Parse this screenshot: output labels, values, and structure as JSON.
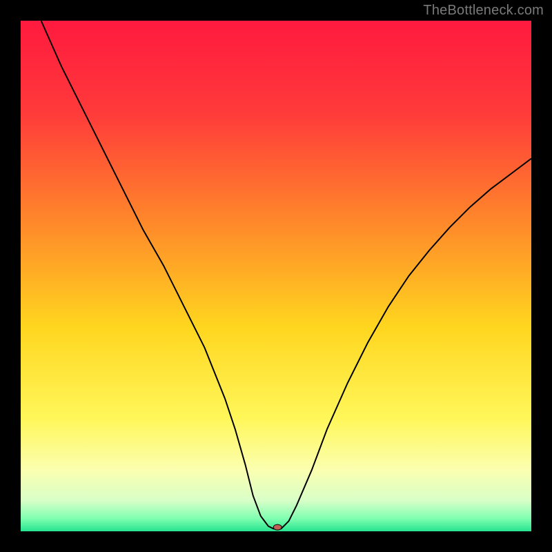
{
  "watermark": "TheBottleneck.com",
  "chart_data": {
    "type": "line",
    "title": "",
    "xlabel": "",
    "ylabel": "",
    "xlim": [
      0,
      100
    ],
    "ylim": [
      0,
      100
    ],
    "background_gradient": {
      "stops": [
        {
          "offset": 0.0,
          "color": "#ff1a3f"
        },
        {
          "offset": 0.18,
          "color": "#ff3a3a"
        },
        {
          "offset": 0.4,
          "color": "#ff8a2a"
        },
        {
          "offset": 0.6,
          "color": "#ffd61f"
        },
        {
          "offset": 0.78,
          "color": "#fff75a"
        },
        {
          "offset": 0.88,
          "color": "#fbffb0"
        },
        {
          "offset": 0.94,
          "color": "#d8ffc8"
        },
        {
          "offset": 0.975,
          "color": "#7fffb0"
        },
        {
          "offset": 1.0,
          "color": "#26e38f"
        }
      ]
    },
    "series": [
      {
        "name": "bottleneck-curve",
        "stroke": "#000000",
        "stroke_width": 2,
        "x": [
          4,
          8,
          12,
          16,
          20,
          24,
          28,
          32,
          36,
          40,
          42,
          44,
          45.5,
          47,
          48.5,
          49.5,
          51,
          52.5,
          54,
          57,
          60,
          64,
          68,
          72,
          76,
          80,
          84,
          88,
          92,
          96,
          100
        ],
        "y": [
          100,
          91,
          83,
          75,
          67,
          59,
          52,
          44,
          36,
          26,
          20,
          13,
          7,
          3,
          1,
          0.5,
          0.5,
          2,
          5,
          12,
          20,
          29,
          37,
          44,
          50,
          55,
          59.5,
          63.5,
          67,
          70,
          73
        ]
      }
    ],
    "marker": {
      "name": "optimal-point",
      "x": 50.3,
      "y": 0.8,
      "rx": 6,
      "ry": 4,
      "fill": "#c06055",
      "stroke": "#000000"
    }
  }
}
